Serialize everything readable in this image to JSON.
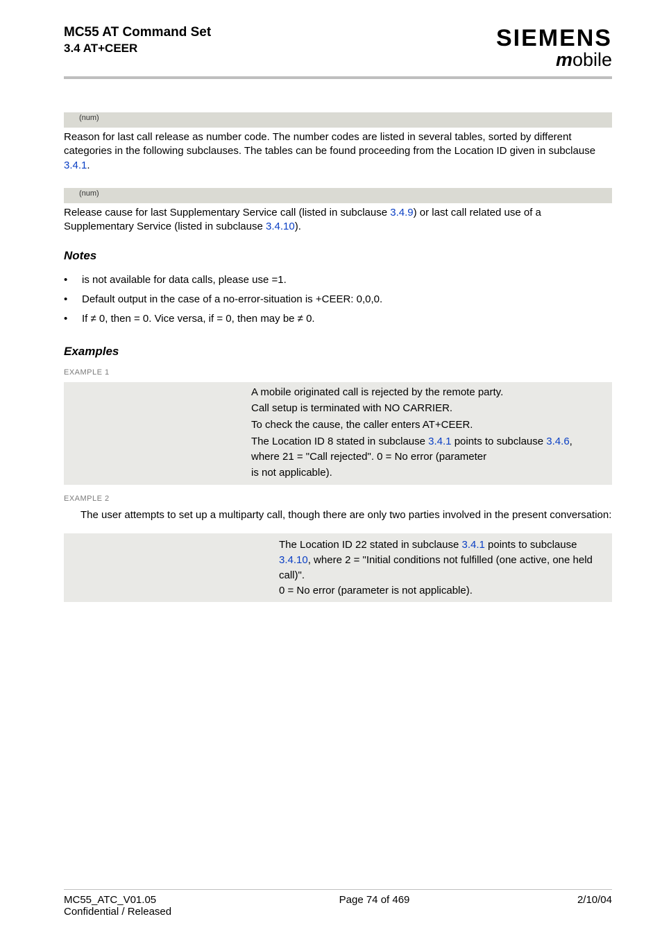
{
  "header": {
    "title1": "MC55 AT Command Set",
    "title2": "3.4 AT+CEER",
    "brand": "SIEMENS",
    "tagline_m": "m",
    "tagline_rest": "obile"
  },
  "param1": {
    "sup": "(num)",
    "body_pre": "Reason for last call release as number code. The number codes are listed in several tables, sorted by different categories in the following subclauses. The tables can be found proceeding from the Location ID given in subclause ",
    "body_link": "3.4.1",
    "body_post": "."
  },
  "param2": {
    "sup": "(num)",
    "body_pre": "Release cause for last Supplementary Service call (listed in subclause ",
    "body_link1": "3.4.9",
    "body_mid": ") or last call related use of a Supplementary Service (listed in subclause ",
    "body_link2": "3.4.10",
    "body_post": ")."
  },
  "notes_title": "Notes",
  "notes": [
    " is not available for data calls, please use =1.",
    "Default output in the case of a no-error-situation is +CEER: 0,0,0.",
    "If ≠ 0, then = 0. Vice versa, if = 0, then may be ≠ 0."
  ],
  "note1_pre": " is not available for data calls, please use ",
  "note1_post": "=1.",
  "note3_if": "If ",
  "note3_a": " ≠ 0, then ",
  "note3_b": " = 0. Vice versa, if ",
  "note3_c": " = 0, then ",
  "note3_d": " may be ≠ 0.",
  "examples_title": "Examples",
  "ex1_label": "EXAMPLE 1",
  "ex1_rows": [
    {
      "left": "",
      "right": "A mobile originated call is rejected by the remote party."
    },
    {
      "left": "",
      "right": "Call setup is terminated with NO CARRIER."
    },
    {
      "left": "",
      "right": "To check the cause, the caller enters AT+CEER."
    },
    {
      "left": "",
      "right_pre": "The Location ID 8 stated in subclause ",
      "link1": "3.4.1",
      "mid": " points to subclause ",
      "link2": "3.4.6",
      "post": ", where 21 = \"Call rejected\". 0 = No error (parameter "
    },
    {
      "left": "",
      "right": " is not applicable)."
    }
  ],
  "ex2_label": "EXAMPLE 2",
  "ex2_para": "The user attempts to set up a multiparty call, though there are only two parties involved in the present conversation:",
  "ex2_rows": [
    {
      "left": "",
      "right": ""
    },
    {
      "left": "",
      "right": ""
    },
    {
      "left": "",
      "right": ""
    },
    {
      "left": "",
      "right": ""
    },
    {
      "left": "",
      "right": ""
    },
    {
      "left": "",
      "right": ""
    },
    {
      "left": "",
      "right_pre": "The Location ID 22 stated in subclause ",
      "link1": "3.4.1",
      "mid": " points to subclause ",
      "link2": "3.4.10",
      "post": ", where 2 = \"Initial conditions not fulfilled (one active, one held call)\"."
    },
    {
      "left": "",
      "right": "0 = No error (parameter  is not applicable)."
    }
  ],
  "footer": {
    "left1": "MC55_ATC_V01.05",
    "left2": "Confidential / Released",
    "center": "Page 74 of 469",
    "right": "2/10/04"
  }
}
